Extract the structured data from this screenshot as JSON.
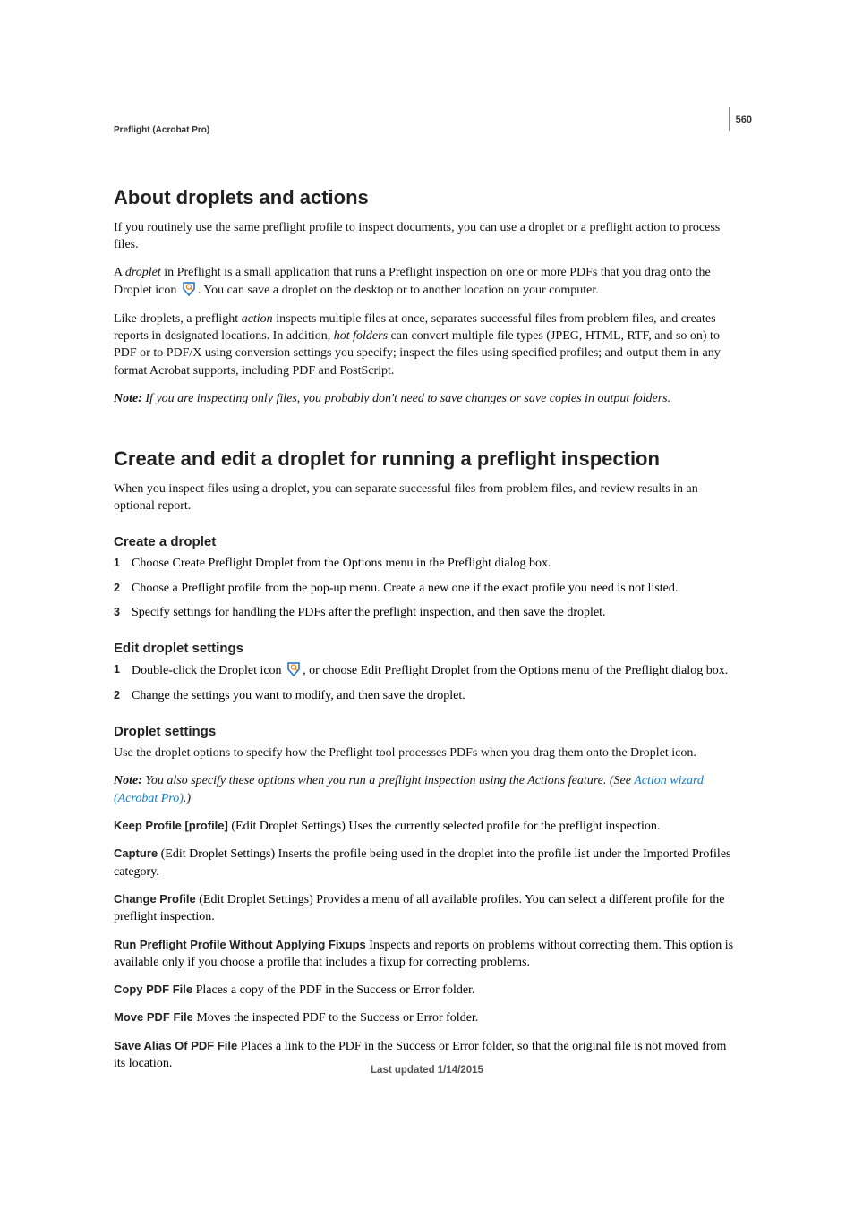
{
  "page_number": "560",
  "breadcrumb": "Preflight (Acrobat Pro)",
  "s1": {
    "title": "About droplets and actions",
    "p1": "If you routinely use the same preflight profile to inspect documents, you can use a droplet or a preflight action to process files.",
    "p2a": "A ",
    "p2_em1": "droplet",
    "p2b": " in Preflight is a small application that runs a Preflight inspection on one or more PDFs that you drag onto the Droplet icon ",
    "p2c": ". You can save a droplet on the desktop or to another location on your computer.",
    "p3a": "Like droplets, a preflight ",
    "p3_em1": "action",
    "p3b": " inspects multiple files at once, separates successful files from problem files, and creates reports in designated locations. In addition, ",
    "p3_em2": "hot folders",
    "p3c": " can convert multiple file types (JPEG, HTML, RTF, and so on) to PDF or to PDF/X using conversion settings you specify; inspect the files using specified profiles; and output them in any format Acrobat supports, including PDF and PostScript.",
    "note_label": "Note:",
    "note": " If you are inspecting only files, you probably don't need to save changes or save copies in output folders."
  },
  "s2": {
    "title": "Create and edit a droplet for running a preflight inspection",
    "p1": "When you inspect files using a droplet, you can separate successful files from problem files, and review results in an optional report.",
    "h_create": "Create a droplet",
    "create_steps": [
      "Choose Create Preflight Droplet from the Options menu in the Preflight dialog box.",
      "Choose a Preflight profile from the pop-up menu. Create a new one if the exact profile you need is not listed.",
      "Specify settings for handling the PDFs after the preflight inspection, and then save the droplet."
    ],
    "h_edit": "Edit droplet settings",
    "edit_step1a": "Double-click the Droplet icon ",
    "edit_step1b": ", or choose Edit Preflight Droplet from the Options menu of the Preflight dialog box.",
    "edit_step2": "Change the settings you want to modify, and then save the droplet.",
    "h_settings": "Droplet settings",
    "p_settings": "Use the droplet options to specify how the Preflight tool processes PDFs when you drag them onto the Droplet icon.",
    "note2_label": "Note:",
    "note2a": " You also specify these options when you run a preflight inspection using the Actions feature. (See ",
    "note2_link": "Action wizard (Acrobat Pro)",
    "note2b": ".)",
    "defs": {
      "keep_term": "Keep Profile [profile]",
      "keep_desc": "  (Edit Droplet Settings) Uses the currently selected profile for the preflight inspection.",
      "capture_term": "Capture",
      "capture_desc": "  (Edit Droplet Settings) Inserts the profile being used in the droplet into the profile list under the Imported Profiles category.",
      "change_term": "Change Profile",
      "change_desc": "  (Edit Droplet Settings) Provides a menu of all available profiles. You can select a different profile for the preflight inspection.",
      "run_term": "Run Preflight Profile Without Applying Fixups",
      "run_desc": "  Inspects and reports on problems without correcting them. This option is available only if you choose a profile that includes a fixup for correcting problems.",
      "copy_term": "Copy PDF File",
      "copy_desc": "  Places a copy of the PDF in the Success or Error folder.",
      "move_term": "Move PDF File",
      "move_desc": "  Moves the inspected PDF to the Success or Error folder.",
      "alias_term": "Save Alias Of PDF File",
      "alias_desc": "  Places a link to the PDF in the Success or Error folder, so that the original file is not moved from its location."
    }
  },
  "footer": "Last updated 1/14/2015"
}
